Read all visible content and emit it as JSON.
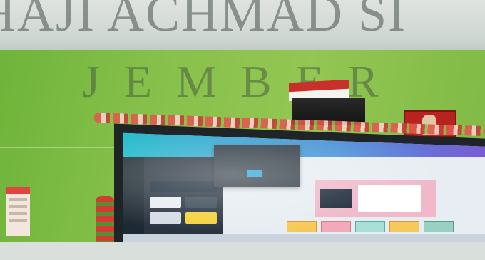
{
  "banner": {
    "title": "HAJI ACHMAD SI",
    "subtitle": "JEMBER"
  },
  "colors": {
    "wall": "#86c04a",
    "flag_red": "#c9302c",
    "screen": "#dbe6ef",
    "app_header": "#1bb9c9"
  }
}
